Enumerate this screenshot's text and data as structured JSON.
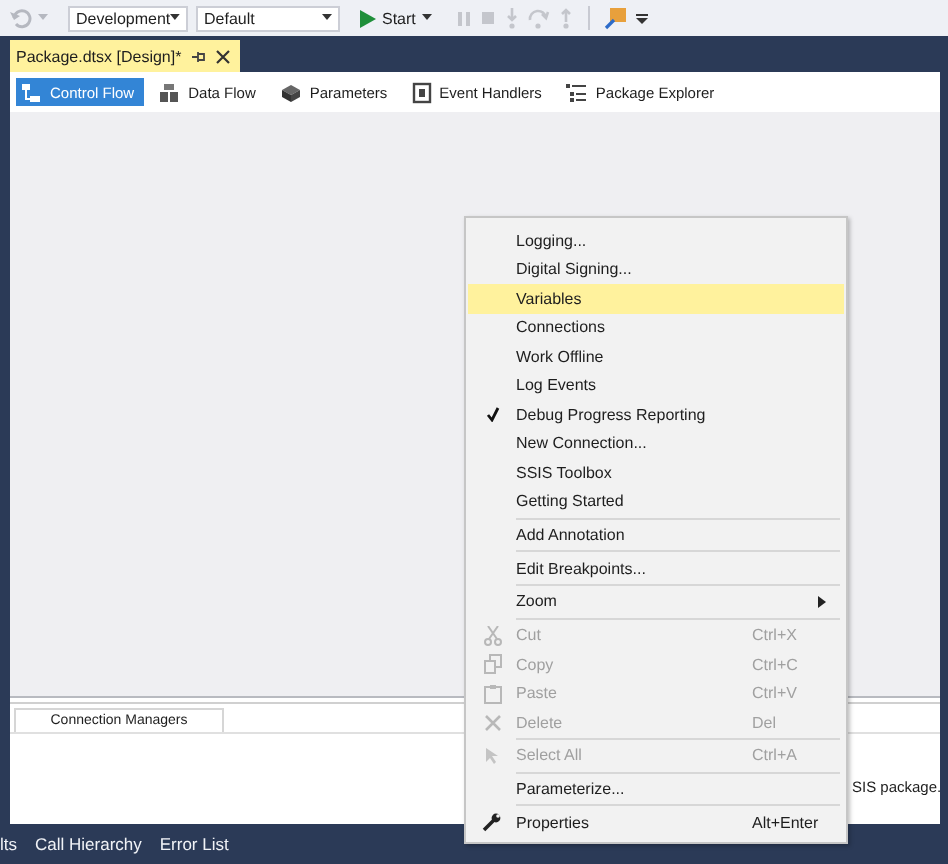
{
  "toolbar": {
    "configuration": "Development",
    "platform": "Default",
    "start_label": "Start"
  },
  "document_tab": {
    "title": "Package.dtsx [Design]*",
    "selected": true
  },
  "designer_tabs": [
    {
      "label": "Control Flow",
      "selected": true
    },
    {
      "label": "Data Flow",
      "selected": false
    },
    {
      "label": "Parameters",
      "selected": false
    },
    {
      "label": "Event Handlers",
      "selected": false
    },
    {
      "label": "Package Explorer",
      "selected": false
    }
  ],
  "connection_managers": {
    "tab": "Connection Managers",
    "hint": "SIS package."
  },
  "context_menu": [
    {
      "kind": "item",
      "label": "Logging...",
      "selected": false,
      "checked": false,
      "disabled": false
    },
    {
      "kind": "item",
      "label": "Digital Signing...",
      "selected": false,
      "checked": false,
      "disabled": false
    },
    {
      "kind": "item",
      "label": "Variables",
      "selected": true,
      "checked": false,
      "disabled": false
    },
    {
      "kind": "item",
      "label": "Connections",
      "selected": false,
      "checked": false,
      "disabled": false
    },
    {
      "kind": "item",
      "label": "Work Offline",
      "selected": false,
      "checked": false,
      "disabled": false
    },
    {
      "kind": "item",
      "label": "Log Events",
      "selected": false,
      "checked": false,
      "disabled": false
    },
    {
      "kind": "item",
      "label": "Debug Progress Reporting",
      "selected": false,
      "checked": true,
      "disabled": false
    },
    {
      "kind": "item",
      "label": "New Connection...",
      "selected": false,
      "checked": false,
      "disabled": false
    },
    {
      "kind": "item",
      "label": "SSIS Toolbox",
      "selected": false,
      "checked": false,
      "disabled": false
    },
    {
      "kind": "item",
      "label": "Getting Started",
      "selected": false,
      "checked": false,
      "disabled": false
    },
    {
      "kind": "separator"
    },
    {
      "kind": "item",
      "label": "Add Annotation",
      "selected": false,
      "checked": false,
      "disabled": false
    },
    {
      "kind": "separator"
    },
    {
      "kind": "item",
      "label": "Edit Breakpoints...",
      "selected": false,
      "checked": false,
      "disabled": false
    },
    {
      "kind": "separator"
    },
    {
      "kind": "submenu",
      "label": "Zoom",
      "selected": false,
      "checked": false,
      "disabled": false
    },
    {
      "kind": "separator"
    },
    {
      "kind": "item",
      "label": "Cut",
      "shortcut": "Ctrl+X",
      "selected": false,
      "checked": false,
      "disabled": true
    },
    {
      "kind": "item",
      "label": "Copy",
      "shortcut": "Ctrl+C",
      "selected": false,
      "checked": false,
      "disabled": true
    },
    {
      "kind": "item",
      "label": "Paste",
      "shortcut": "Ctrl+V",
      "selected": false,
      "checked": false,
      "disabled": true
    },
    {
      "kind": "item",
      "label": "Delete",
      "shortcut": "Del",
      "selected": false,
      "checked": false,
      "disabled": true
    },
    {
      "kind": "separator"
    },
    {
      "kind": "item",
      "label": "Select All",
      "shortcut": "Ctrl+A",
      "selected": false,
      "checked": false,
      "disabled": true
    },
    {
      "kind": "separator"
    },
    {
      "kind": "item",
      "label": "Parameterize...",
      "selected": false,
      "checked": false,
      "disabled": false
    },
    {
      "kind": "separator"
    },
    {
      "kind": "item",
      "label": "Properties",
      "shortcut": "Alt+Enter",
      "selected": false,
      "checked": false,
      "disabled": false
    }
  ],
  "bottom_tabs": [
    "lts",
    "Call Hierarchy",
    "Error List"
  ]
}
